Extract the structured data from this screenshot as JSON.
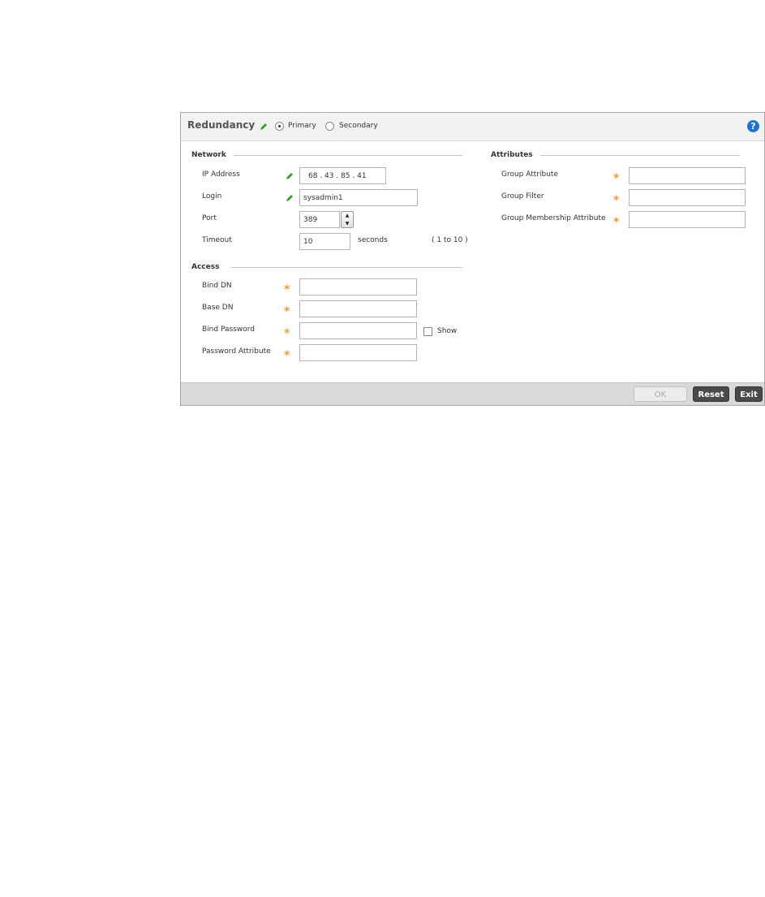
{
  "header": {
    "title": "Redundancy",
    "primary_label": "Primary",
    "secondary_label": "Secondary",
    "selected": "Primary",
    "help": "?"
  },
  "network": {
    "section_title": "Network",
    "ip_label": "IP Address",
    "ip_value": "68 . 43 . 85 . 41",
    "login_label": "Login",
    "login_value": "sysadmin1",
    "port_label": "Port",
    "port_value": "389",
    "timeout_label": "Timeout",
    "timeout_value": "10",
    "timeout_unit": "seconds",
    "timeout_range": "( 1 to 10 )"
  },
  "access": {
    "section_title": "Access",
    "bind_dn_label": "Bind DN",
    "bind_dn_value": "",
    "base_dn_label": "Base DN",
    "base_dn_value": "",
    "bind_password_label": "Bind Password",
    "bind_password_value": "",
    "show_label": "Show",
    "password_attr_label": "Password Attribute",
    "password_attr_value": ""
  },
  "attributes": {
    "section_title": "Attributes",
    "group_attr_label": "Group Attribute",
    "group_attr_value": "",
    "group_filter_label": "Group Filter",
    "group_filter_value": "",
    "group_membership_label": "Group Membership Attribute",
    "group_membership_value": ""
  },
  "footer": {
    "ok_label": "OK",
    "reset_label": "Reset",
    "exit_label": "Exit"
  },
  "colors": {
    "required_star": "#f39c2c",
    "help_icon": "#1f74d3",
    "edit_pencil": "#3a9a2a"
  }
}
